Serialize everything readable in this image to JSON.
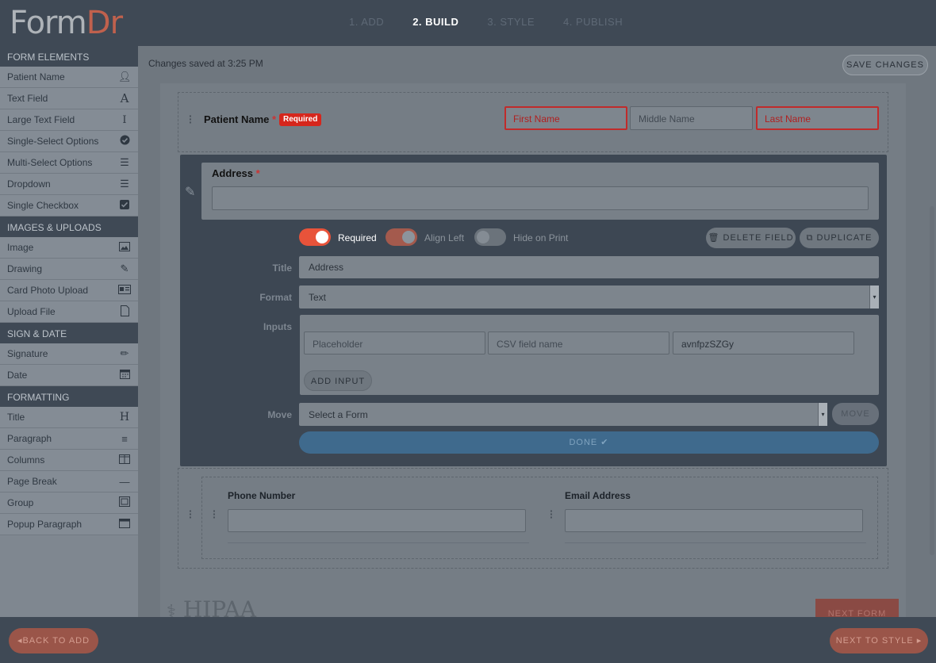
{
  "app": {
    "logo_part1": "Form",
    "logo_part2": "Dr"
  },
  "steps": [
    {
      "label": "1. ADD"
    },
    {
      "label": "2. BUILD"
    },
    {
      "label": "3. STYLE"
    },
    {
      "label": "4. PUBLISH"
    }
  ],
  "sidebar": {
    "form_elements_title": "FORM ELEMENTS",
    "form_elements": [
      {
        "label": "Patient Name",
        "icon": "user-icon"
      },
      {
        "label": "Text Field",
        "icon": "letter-a-icon"
      },
      {
        "label": "Large Text Field",
        "icon": "text-cursor-icon"
      },
      {
        "label": "Single-Select Options",
        "icon": "check-circle-icon"
      },
      {
        "label": "Multi-Select Options",
        "icon": "list-icon"
      },
      {
        "label": "Dropdown",
        "icon": "list-icon"
      },
      {
        "label": "Single Checkbox",
        "icon": "checkbox-icon"
      }
    ],
    "images_title": "IMAGES & UPLOADS",
    "images": [
      {
        "label": "Image",
        "icon": "image-icon"
      },
      {
        "label": "Drawing",
        "icon": "edit-icon"
      },
      {
        "label": "Card Photo Upload",
        "icon": "id-card-icon"
      },
      {
        "label": "Upload File",
        "icon": "pdf-file-icon"
      }
    ],
    "sign_title": "SIGN & DATE",
    "sign": [
      {
        "label": "Signature",
        "icon": "pencil-icon"
      },
      {
        "label": "Date",
        "icon": "calendar-icon"
      }
    ],
    "formatting_title": "FORMATTING",
    "formatting": [
      {
        "label": "Title",
        "icon": "heading-icon"
      },
      {
        "label": "Paragraph",
        "icon": "align-left-icon"
      },
      {
        "label": "Columns",
        "icon": "columns-icon"
      },
      {
        "label": "Page Break",
        "icon": "minus-icon"
      },
      {
        "label": "Group",
        "icon": "group-icon"
      },
      {
        "label": "Popup Paragraph",
        "icon": "window-icon"
      }
    ]
  },
  "main": {
    "saved_text": "Changes saved at 3:25 PM",
    "save_button": "SAVE CHANGES"
  },
  "patient_field": {
    "label": "Patient Name",
    "star": "*",
    "badge": "Required",
    "first_placeholder": "First Name",
    "middle_placeholder": "Middle Name",
    "last_placeholder": "Last Name"
  },
  "address_field": {
    "label": "Address",
    "star": "*"
  },
  "editor": {
    "required_label": "Required",
    "required_on": true,
    "align_left_label": "Align Left",
    "align_left_on": true,
    "hide_print_label": "Hide on Print",
    "hide_print_on": false,
    "delete_button": "DELETE FIELD",
    "duplicate_button": "DUPLICATE",
    "title_label": "Title",
    "title_value": "Address",
    "format_label": "Format",
    "format_value": "Text",
    "inputs_label": "Inputs",
    "input_placeholder": "Placeholder",
    "input_csv": "CSV field name",
    "input_id": "avnfpzSZGy",
    "add_input_button": "ADD INPUT",
    "move_label": "Move",
    "move_select": "Select a Form",
    "move_button": "MOVE",
    "done_button": "DONE ✔"
  },
  "contact_fields": {
    "phone_label": "Phone Number",
    "email_label": "Email Address"
  },
  "footer": {
    "hipaa": "HIPAA",
    "next_form": "NEXT FORM",
    "back_button": "◂BACK TO ADD",
    "next_button": "NEXT TO STYLE ▸"
  },
  "colors": {
    "accent": "#e8533a",
    "required_badge": "#d6261c",
    "header": "#3f4955",
    "done": "#3f6a8d"
  }
}
